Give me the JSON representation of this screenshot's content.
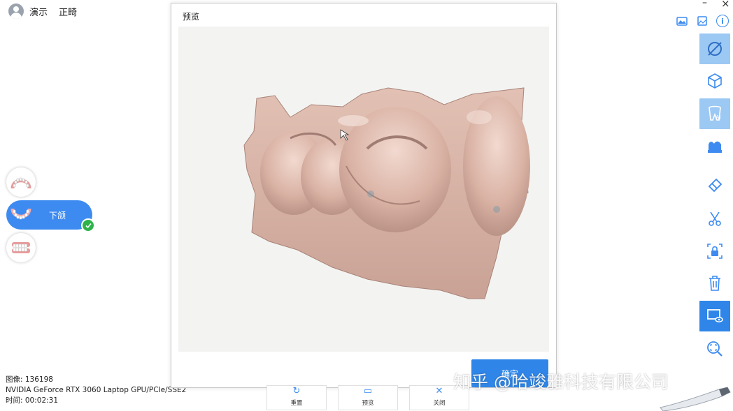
{
  "header": {
    "username": "演示",
    "patient": "正畸"
  },
  "window": {
    "minimize": "–",
    "close": "×"
  },
  "jaw_selector": {
    "upper_icon": "upper-jaw-icon",
    "lower_label": "下颌",
    "lower_icon": "lower-jaw-icon",
    "lower_status": "checkmark-icon",
    "bite_icon": "bite-icon"
  },
  "info": {
    "image_count": "图像: 136198",
    "gpu": "NVIDIA GeForce RTX 3060 Laptop GPU/PCIe/SSE2",
    "time": "时间: 00:02:31"
  },
  "dialog": {
    "title": "预览",
    "confirm_label": "确定"
  },
  "bottom_toolbar": {
    "reset_label": "重置",
    "preview_label": "预览",
    "close_label": "关闭"
  },
  "top_right_icons": [
    "image-gallery-icon",
    "image-icon",
    "info-icon"
  ],
  "top_right_info_glyph": "i",
  "right_toolbar": [
    {
      "icon": "hide-texture-icon",
      "state": "light"
    },
    {
      "icon": "3d-cube-icon",
      "state": "normal"
    },
    {
      "icon": "ai-tooth-icon",
      "state": "light"
    },
    {
      "icon": "model-base-icon",
      "state": "normal"
    },
    {
      "icon": "eraser-icon",
      "state": "normal"
    },
    {
      "icon": "scissors-icon",
      "state": "normal"
    },
    {
      "icon": "lock-selection-icon",
      "state": "normal"
    },
    {
      "icon": "trash-icon",
      "state": "normal"
    },
    {
      "icon": "screen-preview-icon",
      "state": "active"
    },
    {
      "icon": "zoom-fit-icon",
      "state": "normal"
    }
  ],
  "watermark": "知乎 @哈竣雅科技有限公司",
  "colors": {
    "accent": "#2f86e8",
    "accent_light": "#9cc8f4",
    "success": "#2db34a",
    "preview_bg": "#f3f4f2",
    "model_tone": "#d8b3a5"
  }
}
